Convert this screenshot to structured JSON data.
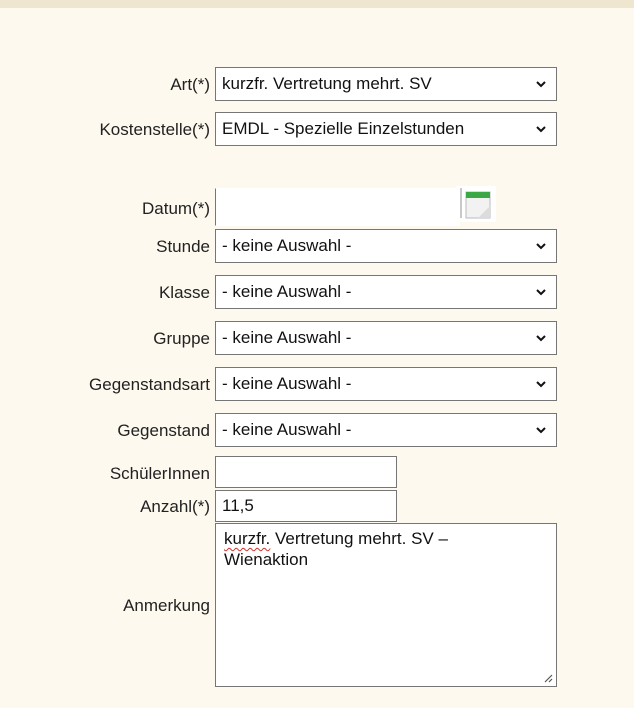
{
  "form": {
    "art": {
      "label": "Art(*)",
      "value": "kurzfr. Vertretung mehrt. SV"
    },
    "kostenstelle": {
      "label": "Kostenstelle(*)",
      "value": "EMDL - Spezielle Einzelstunden"
    },
    "datum": {
      "label": "Datum(*)",
      "value": ""
    },
    "stunde": {
      "label": "Stunde",
      "value": "- keine Auswahl -"
    },
    "klasse": {
      "label": "Klasse",
      "value": "- keine Auswahl -"
    },
    "gruppe": {
      "label": "Gruppe",
      "value": "- keine Auswahl -"
    },
    "gegenstandsart": {
      "label": "Gegenstandsart",
      "value": "- keine Auswahl -"
    },
    "gegenstand": {
      "label": "Gegenstand",
      "value": "- keine Auswahl -"
    },
    "schuelerinnen": {
      "label": "SchülerInnen",
      "value": ""
    },
    "anzahl": {
      "label": "Anzahl(*)",
      "value": "11,5"
    },
    "anmerkung": {
      "label": "Anmerkung",
      "value_misspelled_word": "kurzfr.",
      "value_rest": " Vertretung mehrt. SV –\nWienaktion"
    }
  },
  "icons": {
    "dropdown": "chevron-down-icon",
    "calendar": "calendar-icon",
    "resize": "resize-grip-icon"
  },
  "colors": {
    "background": "#fdf9ef",
    "top_bar": "#efe6cf",
    "calendar_accent": "#3aa845",
    "spellcheck": "#d0312d"
  }
}
